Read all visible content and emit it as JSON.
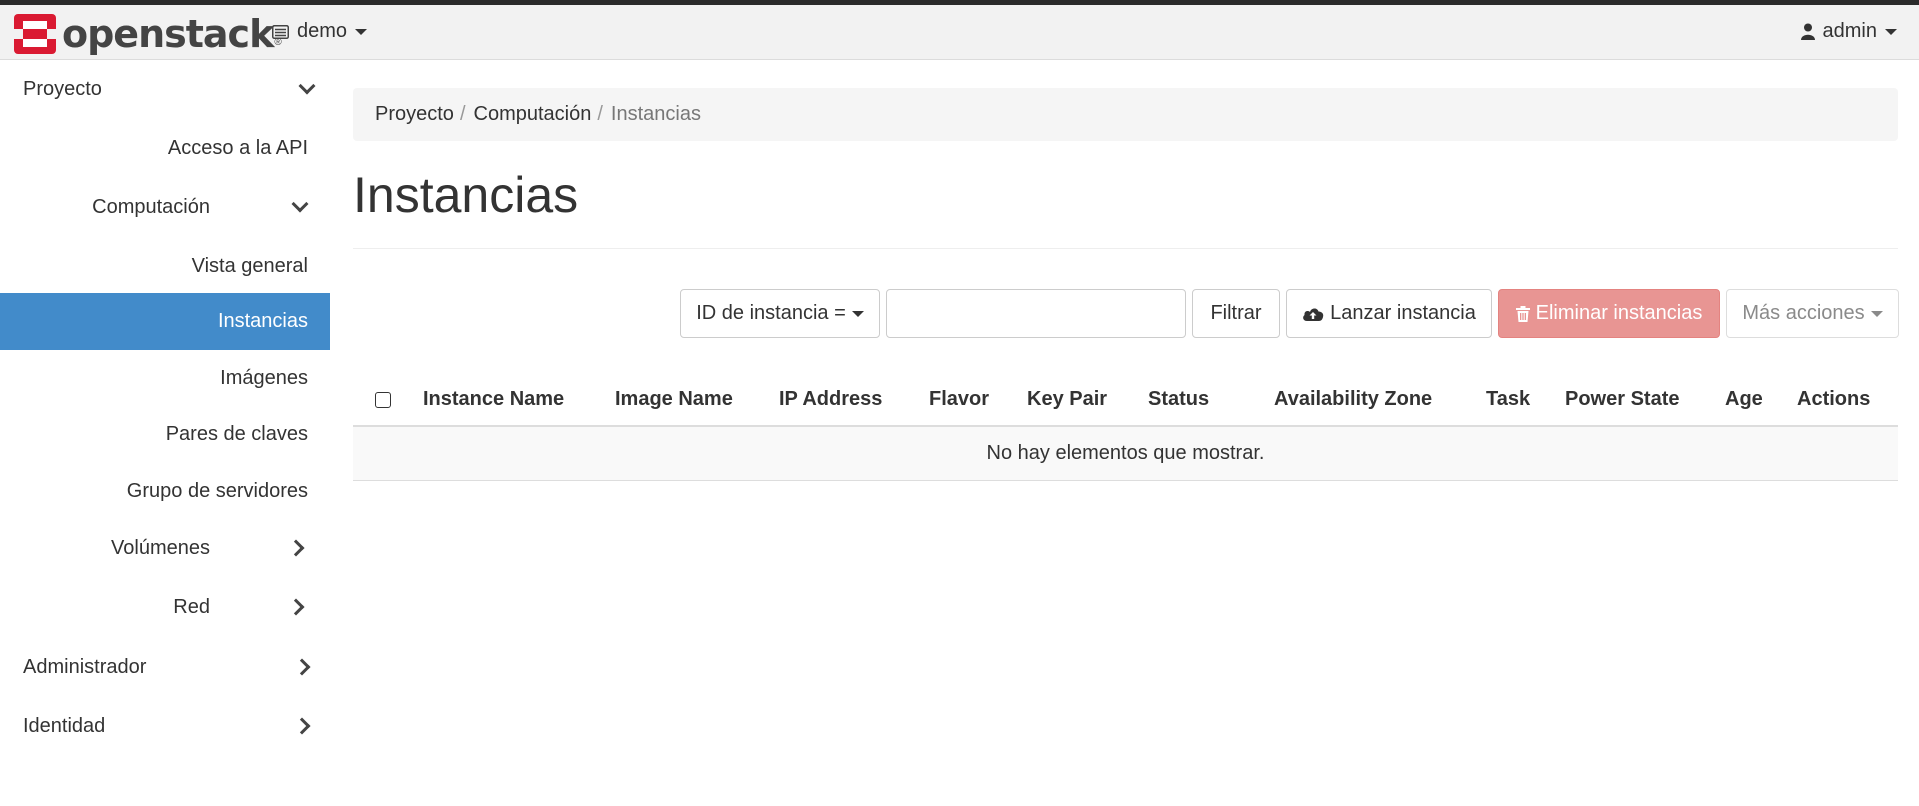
{
  "header": {
    "brand": "openstack",
    "brand_mark": "®",
    "project": "demo",
    "user": "admin"
  },
  "sidebar": {
    "items": [
      {
        "label": "Proyecto"
      },
      {
        "label": "Acceso a la API"
      },
      {
        "label": "Computación"
      },
      {
        "label": "Vista general"
      },
      {
        "label": "Instancias"
      },
      {
        "label": "Imágenes"
      },
      {
        "label": "Pares de claves"
      },
      {
        "label": "Grupo de servidores"
      },
      {
        "label": "Volúmenes"
      },
      {
        "label": "Red"
      },
      {
        "label": "Administrador"
      },
      {
        "label": "Identidad"
      }
    ]
  },
  "breadcrumb": {
    "items": [
      "Proyecto",
      "Computación",
      "Instancias"
    ],
    "separator": "/"
  },
  "page": {
    "title": "Instancias"
  },
  "toolbar": {
    "filter_field": "ID de instancia =",
    "filter_value": "",
    "filter_label": "Filtrar",
    "launch_label": "Lanzar instancia",
    "delete_label": "Eliminar instancias",
    "more_label": "Más acciones"
  },
  "table": {
    "columns": [
      "Instance Name",
      "Image Name",
      "IP Address",
      "Flavor",
      "Key Pair",
      "Status",
      "Availability Zone",
      "Task",
      "Power State",
      "Age",
      "Actions"
    ],
    "empty_message": "No hay elementos que mostrar."
  },
  "colors": {
    "active_nav": "#428bca",
    "delete_button": "#e89593",
    "brand_red": "#da1a32"
  }
}
